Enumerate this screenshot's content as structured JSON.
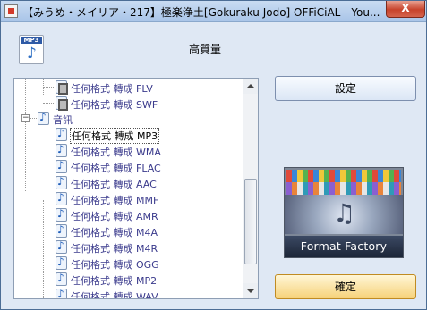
{
  "window": {
    "title": "【みうめ・メイリア・217】極楽浄土[Gokuraku Jodo]  OFFiCiAL - You...",
    "close_label": "X"
  },
  "header": {
    "icon_tag": "MP3",
    "quality_label": "高質量"
  },
  "tree": {
    "items": [
      {
        "label": "任何格式 轉成 FLV",
        "icon": "film-icon",
        "indent": 1
      },
      {
        "label": "任何格式 轉成 SWF",
        "icon": "film-icon",
        "indent": 1
      },
      {
        "label": "音訊",
        "icon": "music-icon",
        "indent": 0
      },
      {
        "label": "任何格式 轉成 MP3",
        "icon": "music-icon",
        "indent": 1,
        "selected": true
      },
      {
        "label": "任何格式 轉成 WMA",
        "icon": "music-icon",
        "indent": 1
      },
      {
        "label": "任何格式 轉成 FLAC",
        "icon": "music-icon",
        "indent": 1
      },
      {
        "label": "任何格式 轉成 AAC",
        "icon": "music-icon",
        "indent": 1
      },
      {
        "label": "任何格式 轉成 MMF",
        "icon": "music-icon",
        "indent": 1
      },
      {
        "label": "任何格式 轉成 AMR",
        "icon": "music-icon",
        "indent": 1
      },
      {
        "label": "任何格式 轉成 M4A",
        "icon": "music-icon",
        "indent": 1
      },
      {
        "label": "任何格式 轉成 M4R",
        "icon": "music-icon",
        "indent": 1
      },
      {
        "label": "任何格式 轉成 OGG",
        "icon": "music-icon",
        "indent": 1
      },
      {
        "label": "任何格式 轉成 MP2",
        "icon": "music-icon",
        "indent": 1
      },
      {
        "label": "任何格式 轉成 WAV",
        "icon": "music-icon",
        "indent": 1
      }
    ],
    "expander_symbol": "−"
  },
  "buttons": {
    "settings_label": "設定",
    "ok_label": "確定"
  },
  "logo": {
    "text": "Format Factory"
  },
  "colors": {
    "window_bg": "#dfe8f4",
    "tree_text": "#3a3a8c",
    "ok_button": "#f6d27a"
  }
}
